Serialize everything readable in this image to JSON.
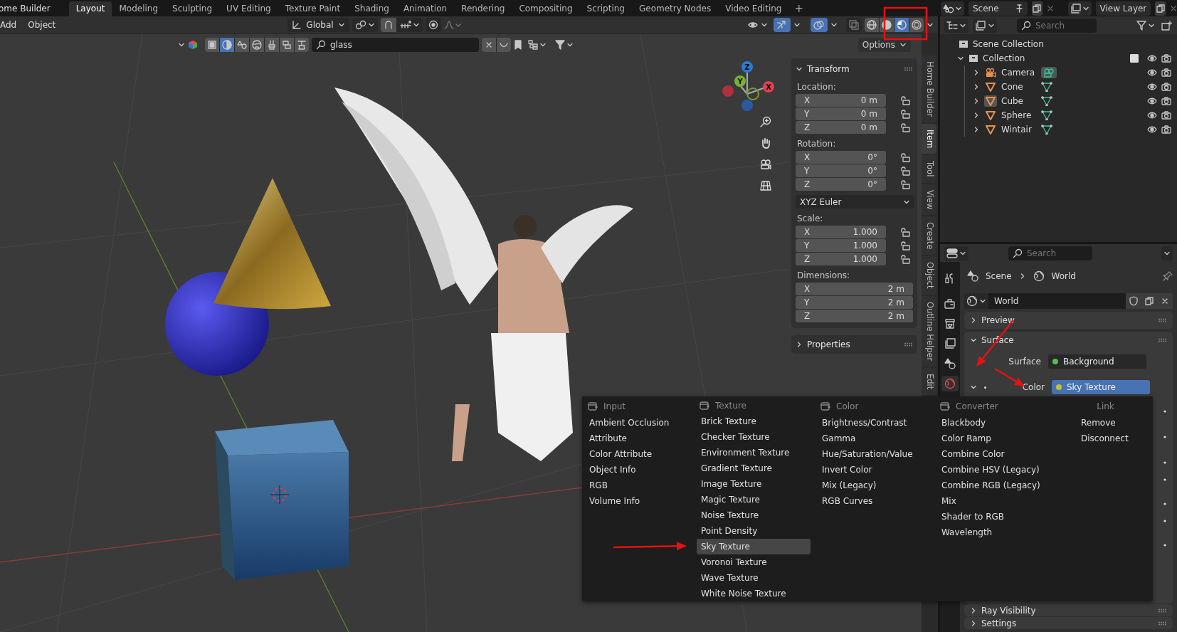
{
  "top_bar": {
    "app_title": "ome Builder",
    "workspaces": [
      {
        "label": "Layout",
        "selected": true
      },
      {
        "label": "Modeling",
        "selected": false
      },
      {
        "label": "Sculpting",
        "selected": false
      },
      {
        "label": "UV Editing",
        "selected": false
      },
      {
        "label": "Texture Paint",
        "selected": false
      },
      {
        "label": "Shading",
        "selected": false
      },
      {
        "label": "Animation",
        "selected": false
      },
      {
        "label": "Rendering",
        "selected": false
      },
      {
        "label": "Compositing",
        "selected": false
      },
      {
        "label": "Scripting",
        "selected": false
      },
      {
        "label": "Geometry Nodes",
        "selected": false
      },
      {
        "label": "Video Editing",
        "selected": false
      }
    ],
    "add_workspace": "+",
    "scene": "Scene",
    "view_layer": "View Layer"
  },
  "viewport": {
    "menus": [
      "Add",
      "Object"
    ],
    "transform_orientation": "Global",
    "shading_modes": [
      {
        "kind": "wireframe",
        "selected": false
      },
      {
        "kind": "solid",
        "selected": false
      },
      {
        "kind": "material",
        "selected": true
      },
      {
        "kind": "rendered",
        "selected": false
      }
    ],
    "filter_toggles": [
      {
        "selected": false
      },
      {
        "selected": true
      },
      {
        "selected": false
      },
      {
        "selected": false
      },
      {
        "selected": false
      },
      {
        "selected": false
      },
      {
        "selected": false
      }
    ],
    "filter_search": {
      "value": "glass"
    },
    "options": "Options",
    "gizmo_axes": [
      "X",
      "Y",
      "Z"
    ]
  },
  "sidebar": {
    "title": "Transform",
    "groups": [
      {
        "kind": "vector_lock",
        "label": "Location:",
        "fields": [
          {
            "axis": "X",
            "value": "0 m"
          },
          {
            "axis": "Y",
            "value": "0 m"
          },
          {
            "axis": "Z",
            "value": "0 m"
          }
        ]
      },
      {
        "kind": "vector_lock",
        "label": "Rotation:",
        "fields": [
          {
            "axis": "X",
            "value": "0°"
          },
          {
            "axis": "Y",
            "value": "0°"
          },
          {
            "axis": "Z",
            "value": "0°"
          }
        ]
      },
      {
        "kind": "dropdown",
        "value": "XYZ Euler"
      },
      {
        "kind": "vector_lock",
        "label": "Scale:",
        "fields": [
          {
            "axis": "X",
            "value": "1.000"
          },
          {
            "axis": "Y",
            "value": "1.000"
          },
          {
            "axis": "Z",
            "value": "1.000"
          }
        ]
      },
      {
        "kind": "vector",
        "label": "Dimensions:",
        "fields": [
          {
            "axis": "X",
            "value": "2 m"
          },
          {
            "axis": "Y",
            "value": "2 m"
          },
          {
            "axis": "Z",
            "value": "2 m"
          }
        ]
      }
    ],
    "properties": "Properties",
    "tabs": [
      {
        "label": "Home Builder",
        "selected": false
      },
      {
        "label": "Item",
        "selected": true
      },
      {
        "label": "Tool",
        "selected": false
      },
      {
        "label": "View",
        "selected": false
      },
      {
        "label": "Create",
        "selected": false
      },
      {
        "label": "Object",
        "selected": false
      },
      {
        "label": "Outline Helper",
        "selected": false
      },
      {
        "label": "Edit",
        "selected": false
      }
    ]
  },
  "outliner": {
    "search": {
      "placeholder": "Search"
    },
    "root": "Scene Collection",
    "collections": [
      {
        "label": "Collection",
        "expanded": true,
        "checked": true,
        "children": [
          {
            "label": "Camera",
            "kind": "camera",
            "selected": false
          },
          {
            "label": "Cone",
            "kind": "mesh",
            "selected": false
          },
          {
            "label": "Cube",
            "kind": "mesh",
            "selected": true
          },
          {
            "label": "Sphere",
            "kind": "mesh",
            "selected": false
          },
          {
            "label": "Wintair",
            "kind": "mesh",
            "selected": false
          }
        ]
      }
    ]
  },
  "properties": {
    "search": {
      "placeholder": "Search"
    },
    "tabs": [
      {
        "kind": "tool",
        "selected": false
      },
      {
        "kind": "render",
        "selected": false
      },
      {
        "kind": "output",
        "selected": false
      },
      {
        "kind": "view_layer",
        "selected": false
      },
      {
        "kind": "scene",
        "selected": false
      },
      {
        "kind": "world",
        "selected": true
      }
    ],
    "breadcrumb": [
      "Scene",
      "World"
    ],
    "world": "World",
    "panels": [
      {
        "title": "Preview",
        "expanded": false
      },
      {
        "title": "Surface",
        "expanded": true,
        "rows": [
          {
            "kind": "socket",
            "label": "Surface",
            "value": "Background",
            "color": "#4fbf4f",
            "selected": false
          },
          {
            "kind": "linked",
            "label": "Color",
            "value": "Sky Texture",
            "color": "#c8c02c",
            "selected": true
          }
        ]
      },
      {
        "title": "Ray Visibility",
        "expanded": false
      },
      {
        "title": "Settings",
        "expanded": false
      }
    ]
  },
  "node_menu": {
    "columns": [
      {
        "kind": "category",
        "heading": "Input",
        "items": [
          {
            "label": "Ambient Occlusion",
            "selected": false
          },
          {
            "label": "Attribute",
            "selected": false
          },
          {
            "label": "Color Attribute",
            "selected": false
          },
          {
            "label": "Object Info",
            "selected": false
          },
          {
            "label": "RGB",
            "selected": false
          },
          {
            "label": "Volume Info",
            "selected": false
          }
        ]
      },
      {
        "kind": "category",
        "heading": "Texture",
        "items": [
          {
            "label": "Brick Texture",
            "selected": false
          },
          {
            "label": "Checker Texture",
            "selected": false
          },
          {
            "label": "Environment Texture",
            "selected": false
          },
          {
            "label": "Gradient Texture",
            "selected": false
          },
          {
            "label": "Image Texture",
            "selected": false
          },
          {
            "label": "Magic Texture",
            "selected": false
          },
          {
            "label": "Noise Texture",
            "selected": false
          },
          {
            "label": "Point Density",
            "selected": false
          },
          {
            "label": "Sky Texture",
            "selected": true
          },
          {
            "label": "Voronoi Texture",
            "selected": false
          },
          {
            "label": "Wave Texture",
            "selected": false
          },
          {
            "label": "White Noise Texture",
            "selected": false
          }
        ]
      },
      {
        "kind": "category",
        "heading": "Color",
        "items": [
          {
            "label": "Brightness/Contrast",
            "selected": false
          },
          {
            "label": "Gamma",
            "selected": false
          },
          {
            "label": "Hue/Saturation/Value",
            "selected": false
          },
          {
            "label": "Invert Color",
            "selected": false
          },
          {
            "label": "Mix (Legacy)",
            "selected": false
          },
          {
            "label": "RGB Curves",
            "selected": false
          }
        ]
      },
      {
        "kind": "category",
        "heading": "Converter",
        "items": [
          {
            "label": "Blackbody",
            "selected": false
          },
          {
            "label": "Color Ramp",
            "selected": false
          },
          {
            "label": "Combine Color",
            "selected": false
          },
          {
            "label": "Combine HSV (Legacy)",
            "selected": false
          },
          {
            "label": "Combine RGB (Legacy)",
            "selected": false
          },
          {
            "label": "Mix",
            "selected": false
          },
          {
            "label": "Shader to RGB",
            "selected": false
          },
          {
            "label": "Wavelength",
            "selected": false
          }
        ]
      },
      {
        "kind": "link",
        "heading": "Link",
        "items": [
          {
            "label": "Remove",
            "selected": false
          },
          {
            "label": "Disconnect",
            "selected": false
          }
        ]
      }
    ]
  }
}
